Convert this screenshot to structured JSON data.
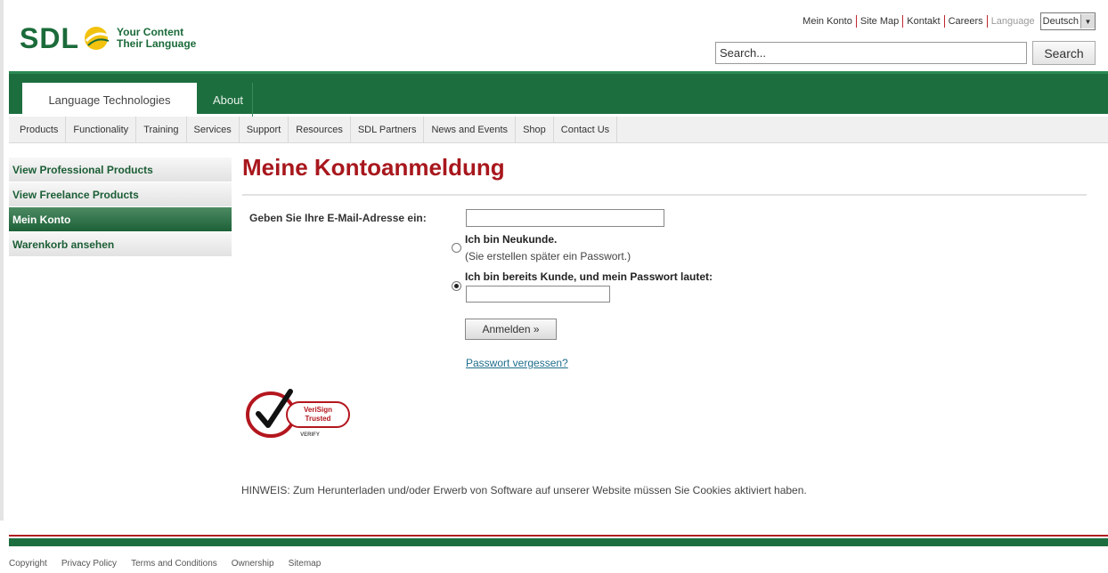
{
  "brand": {
    "logo_text": "SDL",
    "tagline_1": "Your Content",
    "tagline_2": "Their Language",
    "green": "#1d6e3f",
    "red": "#a8171d"
  },
  "top_links": [
    "Mein Konto",
    "Site Map",
    "Kontakt",
    "Careers"
  ],
  "language": {
    "label": "Language",
    "selected": "Deutsch"
  },
  "search": {
    "value": "Search...",
    "button": "Search"
  },
  "main_tabs": {
    "active": "Language Technologies",
    "other": "About"
  },
  "subnav": [
    "Products",
    "Functionality",
    "Training",
    "Services",
    "Support",
    "Resources",
    "SDL Partners",
    "News and Events",
    "Shop",
    "Contact Us"
  ],
  "sidebar": [
    {
      "label": "View Professional Products",
      "active": false
    },
    {
      "label": "View Freelance Products",
      "active": false
    },
    {
      "label": "Mein Konto",
      "active": true
    },
    {
      "label": "Warenkorb ansehen",
      "active": false
    }
  ],
  "page": {
    "title": "Meine Kontoanmeldung",
    "email_label": "Geben Sie Ihre E-Mail-Adresse ein:",
    "email_value": "",
    "radio_new": "Ich bin Neukunde.",
    "radio_new_sub": "(Sie erstellen später ein Passwort.)",
    "radio_existing": "Ich bin bereits Kunde, und mein Passwort lautet:",
    "password_value": "",
    "login_button": "Anmelden »",
    "forgot_link": "Passwort vergessen?",
    "verisign_line1": "VeriSign",
    "verisign_line2": "Trusted",
    "verisign_line3": "VERIFY",
    "notice": "HINWEIS: Zum Herunterladen und/oder Erwerb von Software auf unserer Website müssen Sie Cookies aktiviert haben."
  },
  "footer": [
    "Copyright",
    "Privacy Policy",
    "Terms and Conditions",
    "Ownership",
    "Sitemap"
  ]
}
